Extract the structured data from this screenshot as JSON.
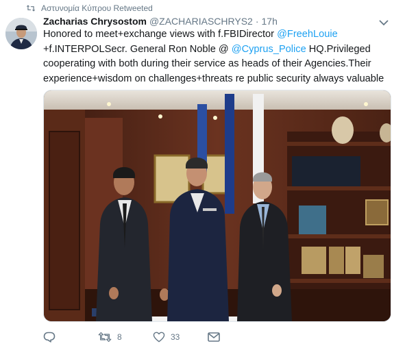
{
  "retweet_bar": {
    "label": "Αστυνομία Κύπρου Retweeted",
    "icon": "retweet-icon"
  },
  "tweet": {
    "author_name": "Zacharias Chrysostom",
    "author_handle": "@ZACHARIASCHRYS2",
    "separator": "·",
    "time": "17h",
    "text_segments": {
      "t1": "Honored to meet+exchange views with f.FBIDirector ",
      "m1": "@FreehLouie",
      "t2": " +f.INTERPOLSecr. General Ron Noble @ ",
      "m2": "@Cyprus_Police",
      "t3": " HQ.Privileged cooperating with both during their service as heads of their Agencies.Their experience+wisdom on challenges+threats re public security always valuable"
    },
    "mention_color": "#1da1f2"
  },
  "actions": {
    "reply_count": "",
    "retweet_count": "8",
    "like_count": "33"
  },
  "colors": {
    "text_primary": "#14171a",
    "text_secondary": "#657786",
    "link": "#1da1f2",
    "border": "#e1e8ed"
  }
}
